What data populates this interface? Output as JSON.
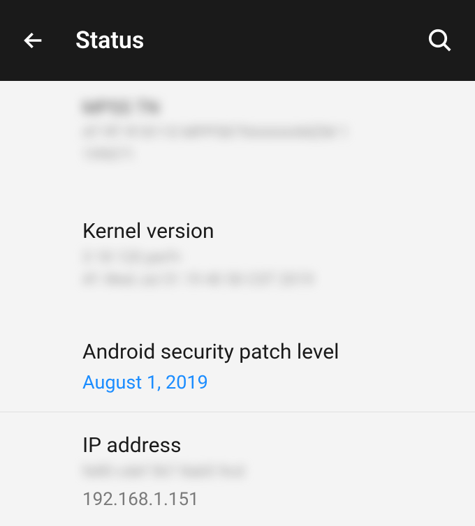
{
  "header": {
    "title": "Status"
  },
  "items": {
    "kernel": {
      "title": "Kernel version"
    },
    "security": {
      "title": "Android security patch level",
      "value": "August 1, 2019"
    },
    "ip": {
      "title": "IP address",
      "value": "192.168.1.151"
    }
  }
}
